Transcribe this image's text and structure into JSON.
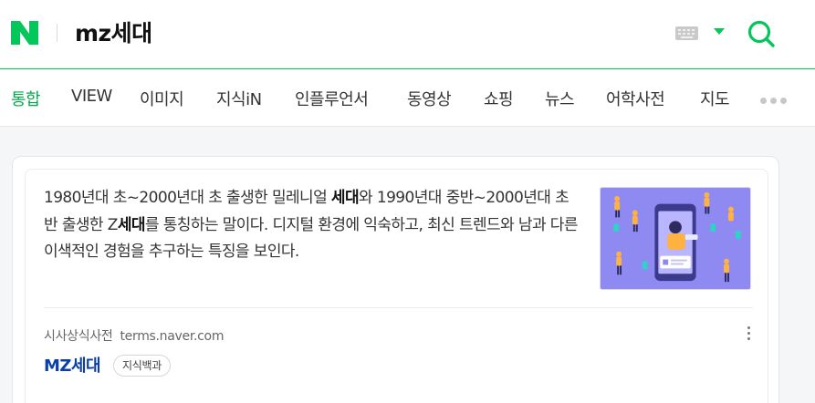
{
  "header": {
    "logo_letter": "N",
    "query": "mz세대",
    "colors": {
      "brand": "#03c75a",
      "link": "#0b3fa8"
    },
    "icons": [
      "keyboard-icon",
      "chevron-down-icon",
      "search-icon"
    ]
  },
  "tabs": {
    "items": [
      {
        "label": "통합",
        "active": true
      },
      {
        "label": "VIEW",
        "active": false
      },
      {
        "label": "이미지",
        "active": false
      },
      {
        "label": "지식iN",
        "active": false
      },
      {
        "label": "인플루언서",
        "active": false
      },
      {
        "label": "동영상",
        "active": false
      },
      {
        "label": "쇼핑",
        "active": false
      },
      {
        "label": "뉴스",
        "active": false
      },
      {
        "label": "어학사전",
        "active": false
      },
      {
        "label": "지도",
        "active": false
      }
    ],
    "more_icon": "more-dots-icon"
  },
  "result": {
    "desc_part1": "1980년대 초~2000년대 초 출생한 밀레니얼 ",
    "desc_bold1": "세대",
    "desc_part2": "와 1990년대 중반~2000년대 초반 출생한 Z",
    "desc_bold2": "세대",
    "desc_part3": "를 통칭하는 말이다. 디지털 환경에 익숙하고, 최신 트렌드와 남과 다른 이색적인 경험을 추구하는 특징을 보인다.",
    "source_name": "시사상식사전",
    "source_domain": "terms.naver.com",
    "title": "MZ세대",
    "badge": "지식백과",
    "thumbnail_icon": "influencer-illustration-image"
  }
}
